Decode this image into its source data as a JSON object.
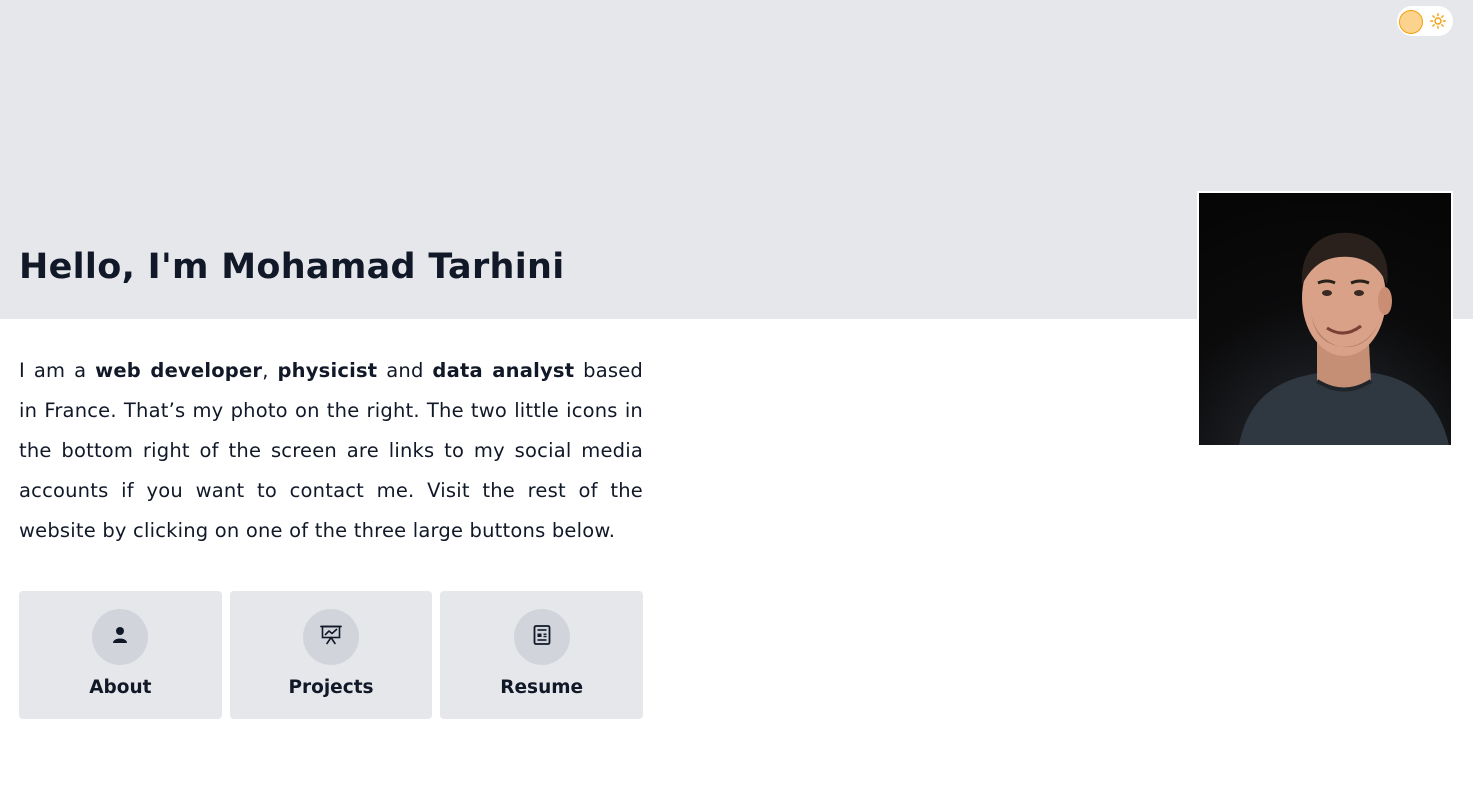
{
  "header": {
    "title": "Hello, I'm Mohamad Tarhini"
  },
  "theme_toggle": {
    "icon": "sun-icon",
    "knob_color": "#fcd38d",
    "accent": "#f59e0b"
  },
  "intro": {
    "part1": "I am a ",
    "role1": "web developer",
    "sep1": ", ",
    "role2": "physicist",
    "sep2": " and ",
    "role3": "data analyst",
    "rest": " based in France. That’s my photo on the right. The two little icons in the bottom right of the screen are links to my social media accounts if you want to contact me. Visit the rest of the website by clicking on one of the three large buttons below."
  },
  "nav": [
    {
      "label": "About",
      "icon": "user-icon"
    },
    {
      "label": "Projects",
      "icon": "presentation-chart-icon"
    },
    {
      "label": "Resume",
      "icon": "document-icon"
    }
  ],
  "colors": {
    "hero_bg": "#e5e7eb",
    "card_bg": "#e5e7eb",
    "icon_circle": "#d1d5db",
    "text": "#111827"
  }
}
